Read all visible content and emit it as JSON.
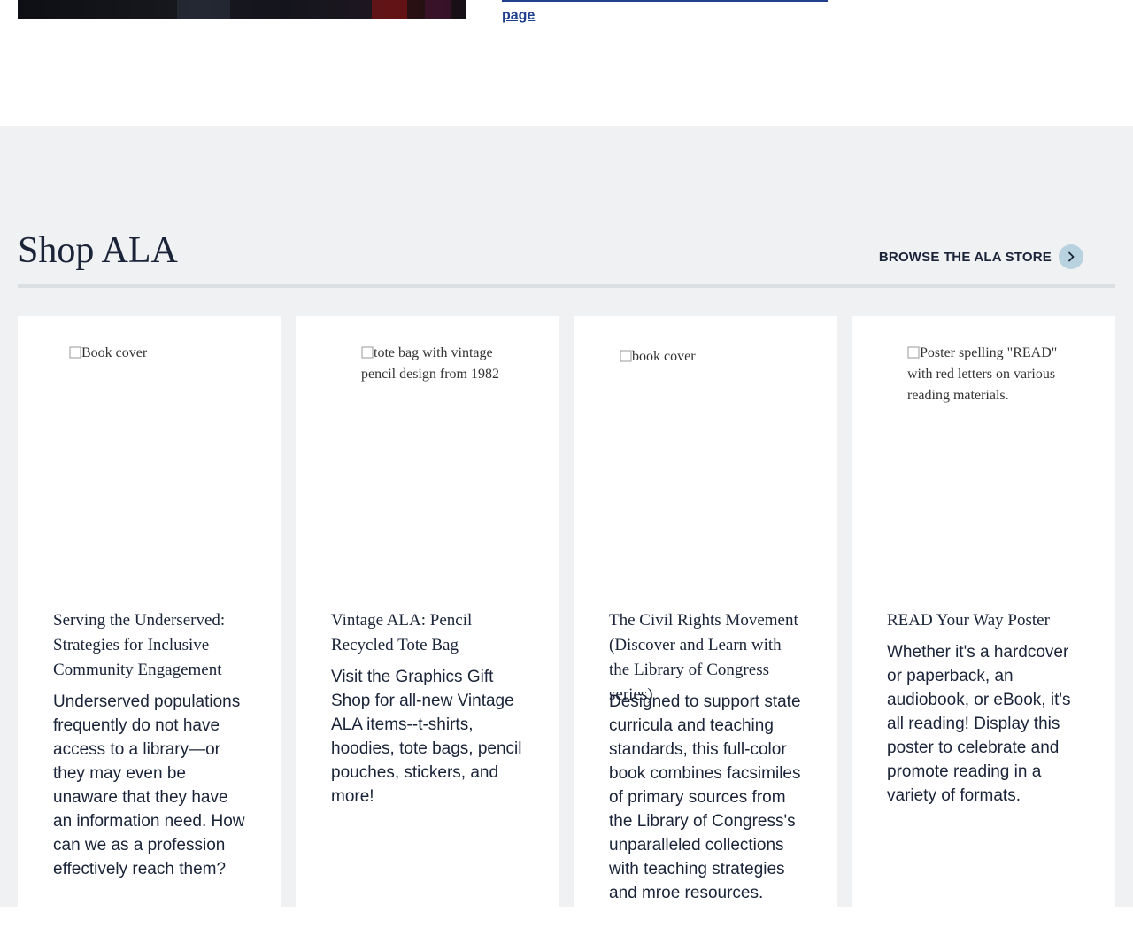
{
  "top": {
    "link_text": "page"
  },
  "shop": {
    "title": "Shop ALA",
    "browse_label": "BROWSE THE ALA STORE",
    "browse_icon": "chevron-right-icon",
    "accent_color": "#b8d3df",
    "products": [
      {
        "image_alt": "Book cover",
        "title": "Serving the Underserved: Strategies for Inclusive Community Engagement",
        "description": "Underserved populations frequently do not have access to a library—or they may even be unaware that they have an information need. How can we as a profession effectively reach them?"
      },
      {
        "image_alt": "tote bag with vintage pencil design from 1982",
        "title": "Vintage ALA: Pencil Recycled Tote Bag",
        "description": "Visit the Graphics Gift Shop for all-new Vintage ALA items--t-shirts, hoodies, tote bags, pencil pouches, stickers, and more!"
      },
      {
        "image_alt": "book cover",
        "title": "The Civil Rights Movement (Discover and Learn with the Library of Congress series)",
        "description": "Designed to support state curricula and teaching standards, this full-color book combines facsimiles of primary sources from the Library of Congress's unparalleled collections with teaching strategies and mroe resources."
      },
      {
        "image_alt": "Poster spelling \"READ\" with red letters on various reading materials.",
        "title": "READ Your Way Poster",
        "description": "Whether it's a hardcover or paperback, an audiobook, or eBook, it's all reading! Display this poster to celebrate and promote reading in a variety of formats."
      }
    ]
  }
}
